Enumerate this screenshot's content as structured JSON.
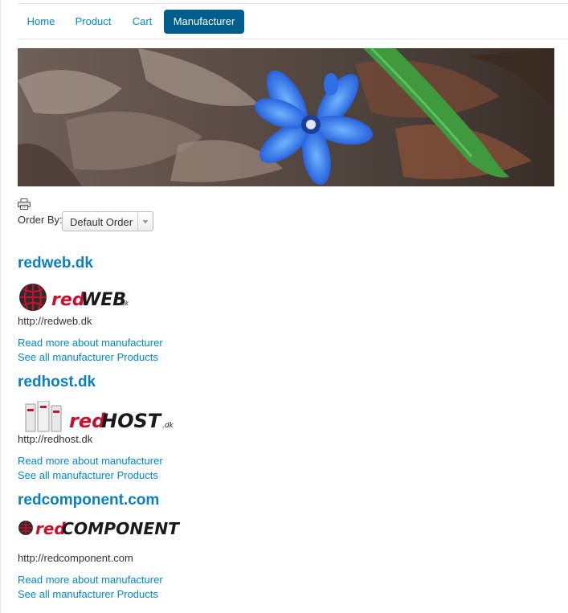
{
  "nav": {
    "items": [
      {
        "label": "Home"
      },
      {
        "label": "Product"
      },
      {
        "label": "Cart"
      },
      {
        "label": "Manufacturer"
      }
    ],
    "active": "Manufacturer"
  },
  "toolbar": {
    "order_by_label": "Order By:",
    "order_select_value": "Default Order"
  },
  "manufacturers": [
    {
      "title": "redweb.dk",
      "logo_text": "redWEB",
      "logo_suffix": ".dk",
      "url": "http://redweb.dk",
      "read_more": "Read more about manufacturer",
      "see_all": "See all manufacturer Products"
    },
    {
      "title": "redhost.dk",
      "logo_text": "redHOST",
      "logo_suffix": ".dk",
      "url": "http://redhost.dk",
      "read_more": "Read more about manufacturer",
      "see_all": "See all manufacturer Products"
    },
    {
      "title": "redcomponent.com",
      "logo_text": "redCOMPONENT",
      "url": "http://redcomponent.com",
      "read_more": "Read more about manufacturer",
      "see_all": "See all manufacturer Products"
    }
  ],
  "colors": {
    "accent": "#0088cc",
    "nav_active_bg": "#005e8d",
    "title": "#0b7fbe",
    "logo_red": "#c8102e"
  }
}
